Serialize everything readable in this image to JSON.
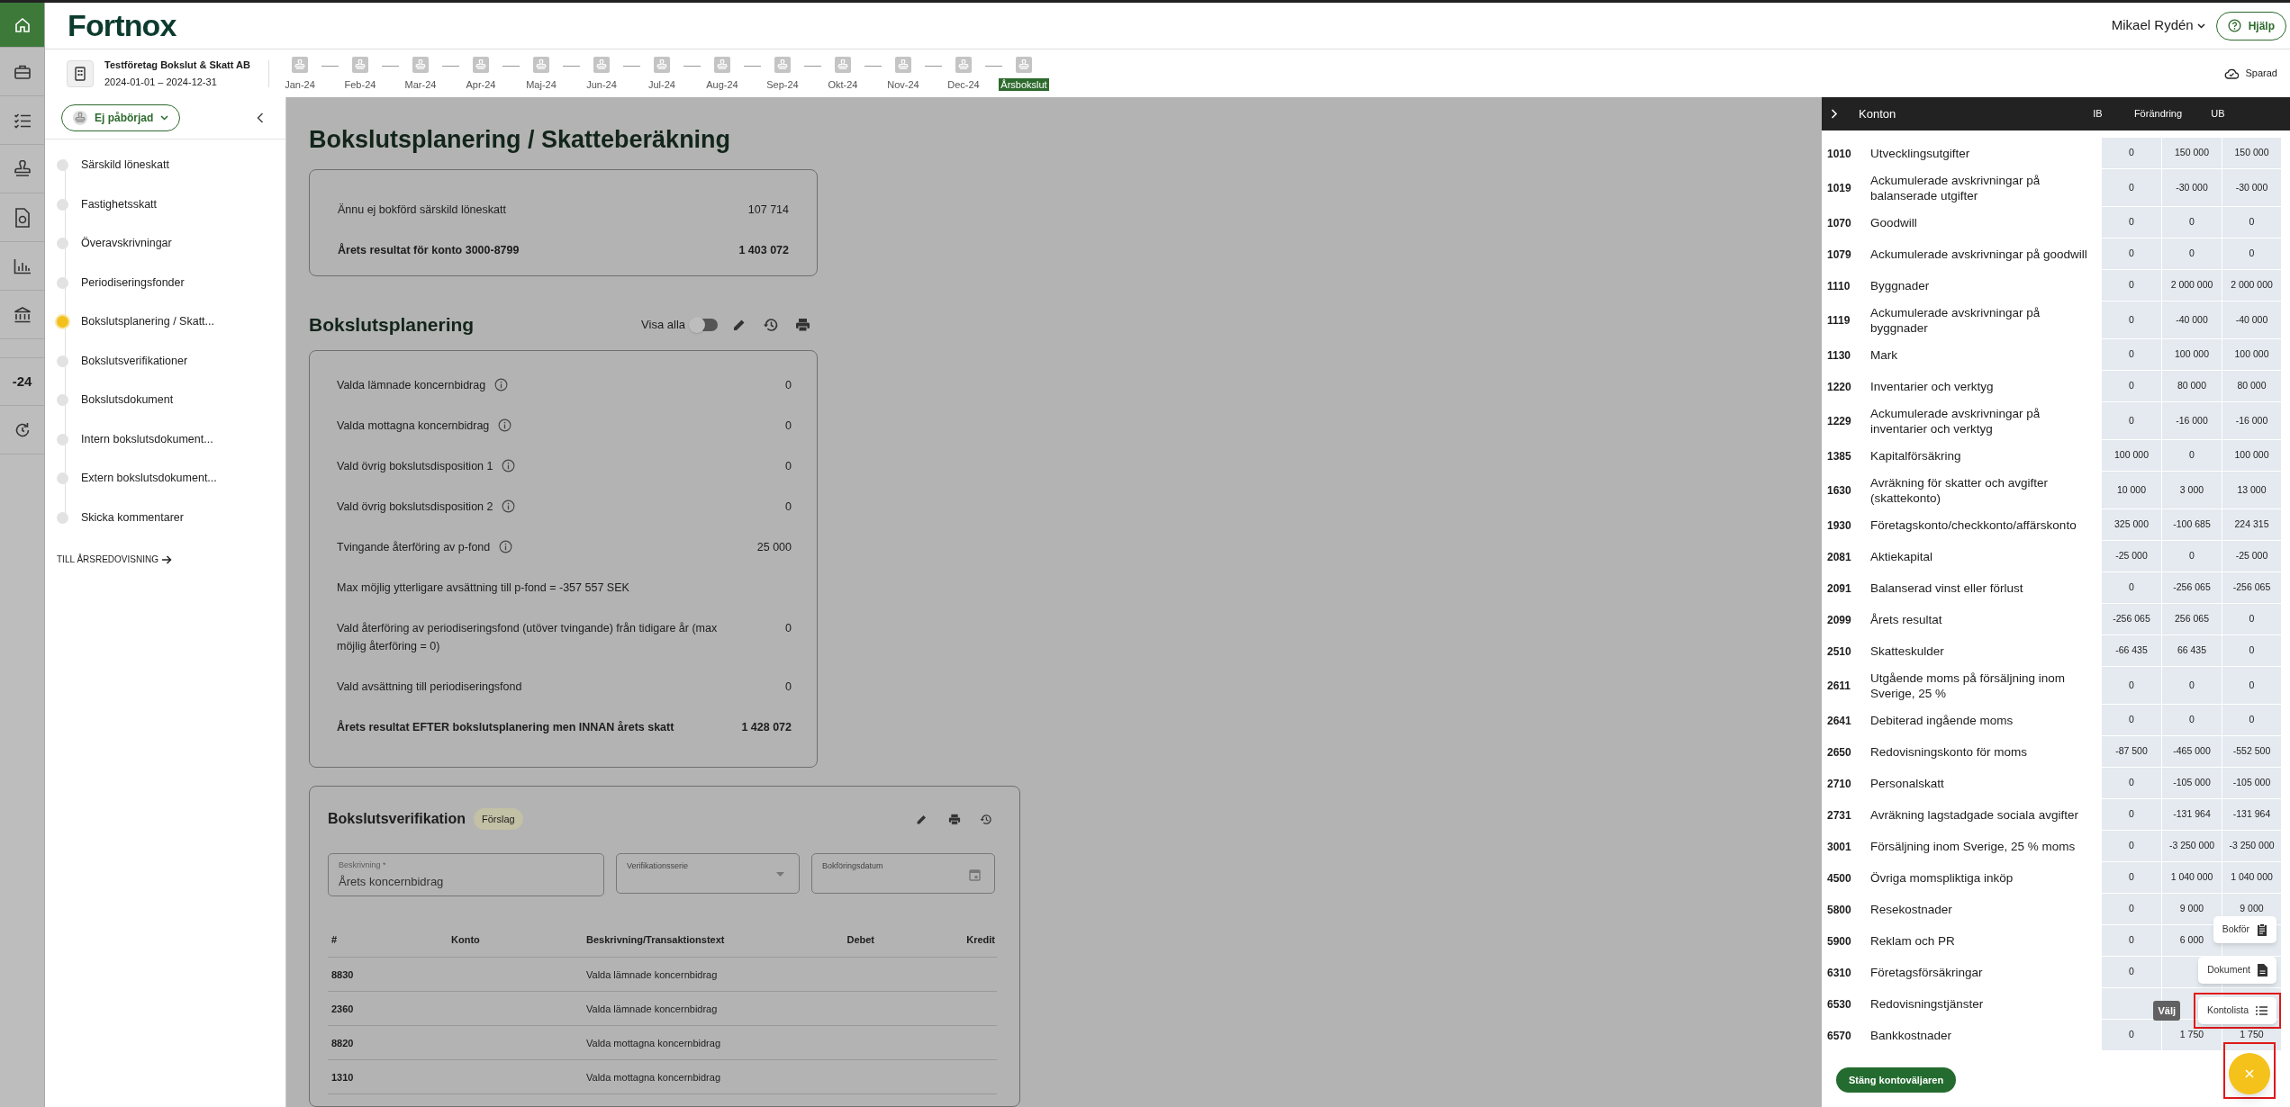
{
  "header": {
    "logo": "Fortnox",
    "user": "Mikael Rydén",
    "help": "Hjälp"
  },
  "rail": [
    {
      "kind": "icon",
      "selected": true
    },
    {
      "kind": "icon",
      "selected": false
    },
    {
      "kind": "icon",
      "selected": false
    },
    {
      "kind": "icon",
      "selected": false
    },
    {
      "kind": "icon",
      "selected": false
    },
    {
      "kind": "icon",
      "selected": false
    },
    {
      "kind": "icon",
      "selected": false
    },
    {
      "kind": "text",
      "label": "-24",
      "selected": false
    },
    {
      "kind": "icon",
      "selected": false
    }
  ],
  "company": {
    "name": "Testföretag Bokslut & Skatt AB",
    "period": "2024-01-01 – 2024-12-31"
  },
  "timeline": [
    {
      "label": "Jan-24",
      "selected": false
    },
    {
      "label": "Feb-24",
      "selected": false
    },
    {
      "label": "Mar-24",
      "selected": false
    },
    {
      "label": "Apr-24",
      "selected": false
    },
    {
      "label": "Maj-24",
      "selected": false
    },
    {
      "label": "Jun-24",
      "selected": false
    },
    {
      "label": "Jul-24",
      "selected": false
    },
    {
      "label": "Aug-24",
      "selected": false
    },
    {
      "label": "Sep-24",
      "selected": false
    },
    {
      "label": "Okt-24",
      "selected": false
    },
    {
      "label": "Nov-24",
      "selected": false
    },
    {
      "label": "Dec-24",
      "selected": false
    },
    {
      "label": "Årsbokslut",
      "selected": true
    }
  ],
  "save_status": "Sparad",
  "nav": {
    "status": "Ej påbörjad",
    "items": [
      {
        "label": "Särskild löneskatt",
        "selected": false
      },
      {
        "label": "Fastighetsskatt",
        "selected": false
      },
      {
        "label": "Överavskrivningar",
        "selected": false
      },
      {
        "label": "Periodiseringsfonder",
        "selected": false
      },
      {
        "label": "Bokslutsplanering / Skatt...",
        "selected": true
      },
      {
        "label": "Bokslutsverifikationer",
        "selected": false
      },
      {
        "label": "Bokslutsdokument",
        "selected": false
      },
      {
        "label": "Intern bokslutsdokument...",
        "selected": false
      },
      {
        "label": "Extern bokslutsdokument...",
        "selected": false
      },
      {
        "label": "Skicka kommentarer",
        "selected": false
      }
    ],
    "link": "TILL ÅRSREDOVISNING"
  },
  "page_title": "Bokslutsplanering / Skatteberäkning",
  "summary": [
    {
      "label": "Ännu ej bokförd särskild löneskatt",
      "value": "107 714",
      "bold": false
    },
    {
      "label": "Årets resultat för konto 3000-8799",
      "value": "1 403 072",
      "bold": true
    }
  ],
  "planning": {
    "title": "Bokslutsplanering",
    "toggle_label": "Visa alla",
    "toggle_on": false,
    "rows": [
      {
        "label": "Valda lämnade koncernbidrag",
        "info": true,
        "value": "0",
        "bold": false
      },
      {
        "label": "Valda mottagna koncernbidrag",
        "info": true,
        "value": "0",
        "bold": false
      },
      {
        "label": "Vald övrig bokslutsdisposition 1",
        "info": true,
        "value": "0",
        "bold": false
      },
      {
        "label": "Vald övrig bokslutsdisposition 2",
        "info": true,
        "value": "0",
        "bold": false
      },
      {
        "label": "Tvingande återföring av p-fond",
        "info": true,
        "value": "25 000",
        "bold": false
      },
      {
        "label": "Max möjlig ytterligare avsättning till p-fond = -357 557 SEK",
        "info": false,
        "bold": false
      },
      {
        "label": "Vald återföring av periodiseringsfond (utöver tvingande) från tidigare år (max möjlig återföring = 0)",
        "info": false,
        "value": "0",
        "bold": false
      },
      {
        "label": "Vald avsättning till periodiseringsfond",
        "info": false,
        "value": "0",
        "bold": false
      },
      {
        "label": "Årets resultat EFTER bokslutsplanering men INNAN årets skatt",
        "info": false,
        "value": "1 428 072",
        "bold": true
      }
    ]
  },
  "verification": {
    "title": "Bokslutsverifikation",
    "badge": "Förslag",
    "fields": [
      {
        "kind": "text",
        "label": "Beskrivning *",
        "value": "Årets koncernbidrag"
      },
      {
        "kind": "select",
        "label": "Verifikationsserie"
      },
      {
        "kind": "date",
        "label": "Bokföringsdatum"
      }
    ],
    "columns": [
      "#",
      "Konto",
      "Beskrivning/Transaktionstext",
      "Debet",
      "Kredit"
    ],
    "rows": [
      {
        "number": "8830",
        "description": "Valda lämnade koncernbidrag"
      },
      {
        "number": "2360",
        "description": "Valda lämnade koncernbidrag"
      },
      {
        "number": "8820",
        "description": "Valda mottagna koncernbidrag"
      },
      {
        "number": "1310",
        "description": "Valda mottagna koncernbidrag"
      }
    ]
  },
  "accounts": {
    "title": "Konton",
    "columns": [
      "IB",
      "Förändring",
      "UB"
    ],
    "rows": [
      {
        "number": "1010",
        "name": "Utvecklingsutgifter",
        "ib": "0",
        "change": "150 000",
        "ub": "150 000"
      },
      {
        "number": "1019",
        "name": "Ackumulerade avskrivningar på balanserade utgifter",
        "ib": "0",
        "change": "-30 000",
        "ub": "-30 000"
      },
      {
        "number": "1070",
        "name": "Goodwill",
        "ib": "0",
        "change": "0",
        "ub": "0"
      },
      {
        "number": "1079",
        "name": "Ackumulerade avskrivningar på goodwill",
        "ib": "0",
        "change": "0",
        "ub": "0"
      },
      {
        "number": "1110",
        "name": "Byggnader",
        "ib": "0",
        "change": "2 000 000",
        "ub": "2 000 000"
      },
      {
        "number": "1119",
        "name": "Ackumulerade avskrivningar på byggnader",
        "ib": "0",
        "change": "-40 000",
        "ub": "-40 000"
      },
      {
        "number": "1130",
        "name": "Mark",
        "ib": "0",
        "change": "100 000",
        "ub": "100 000"
      },
      {
        "number": "1220",
        "name": "Inventarier och verktyg",
        "ib": "0",
        "change": "80 000",
        "ub": "80 000"
      },
      {
        "number": "1229",
        "name": "Ackumulerade avskrivningar på inventarier och verktyg",
        "ib": "0",
        "change": "-16 000",
        "ub": "-16 000"
      },
      {
        "number": "1385",
        "name": "Kapitalförsäkring",
        "ib": "100 000",
        "change": "0",
        "ub": "100 000"
      },
      {
        "number": "1630",
        "name": "Avräkning för skatter och avgifter (skattekonto)",
        "ib": "10 000",
        "change": "3 000",
        "ub": "13 000"
      },
      {
        "number": "1930",
        "name": "Företagskonto/checkkonto/affärskonto",
        "ib": "325 000",
        "change": "-100 685",
        "ub": "224 315"
      },
      {
        "number": "2081",
        "name": "Aktiekapital",
        "ib": "-25 000",
        "change": "0",
        "ub": "-25 000"
      },
      {
        "number": "2091",
        "name": "Balanserad vinst eller förlust",
        "ib": "0",
        "change": "-256 065",
        "ub": "-256 065"
      },
      {
        "number": "2099",
        "name": "Årets resultat",
        "ib": "-256 065",
        "change": "256 065",
        "ub": "0"
      },
      {
        "number": "2510",
        "name": "Skatteskulder",
        "ib": "-66 435",
        "change": "66 435",
        "ub": "0"
      },
      {
        "number": "2611",
        "name": "Utgående moms på försäljning inom Sverige, 25 %",
        "ib": "0",
        "change": "0",
        "ub": "0"
      },
      {
        "number": "2641",
        "name": "Debiterad ingående moms",
        "ib": "0",
        "change": "0",
        "ub": "0"
      },
      {
        "number": "2650",
        "name": "Redovisningskonto för moms",
        "ib": "-87 500",
        "change": "-465 000",
        "ub": "-552 500"
      },
      {
        "number": "2710",
        "name": "Personalskatt",
        "ib": "0",
        "change": "-105 000",
        "ub": "-105 000"
      },
      {
        "number": "2731",
        "name": "Avräkning lagstadgade sociala avgifter",
        "ib": "0",
        "change": "-131 964",
        "ub": "-131 964"
      },
      {
        "number": "3001",
        "name": "Försäljning inom Sverige, 25 % moms",
        "ib": "0",
        "change": "-3 250 000",
        "ub": "-3 250 000"
      },
      {
        "number": "4500",
        "name": "Övriga momspliktiga inköp",
        "ib": "0",
        "change": "1 040 000",
        "ub": "1 040 000"
      },
      {
        "number": "5800",
        "name": "Resekostnader",
        "ib": "0",
        "change": "9 000",
        "ub": "9 000"
      },
      {
        "number": "5900",
        "name": "Reklam och PR",
        "ib": "0",
        "change": "6 000"
      },
      {
        "number": "6310",
        "name": "Företagsförsäkringar",
        "ib": "0"
      },
      {
        "number": "6530",
        "name": "Redovisningstjänster"
      },
      {
        "number": "6570",
        "name": "Bankkostnader",
        "ib": "0",
        "change": "1 750",
        "ub": "1 750"
      }
    ],
    "close_button": "Stäng kontoväljaren"
  },
  "fab_menu": {
    "items": [
      {
        "label": "Bokför",
        "highlighted": false
      },
      {
        "label": "Dokument",
        "highlighted": false
      },
      {
        "label": "Kontolista",
        "highlighted": true
      }
    ],
    "tooltip": "Välj",
    "fab_highlighted": true
  }
}
